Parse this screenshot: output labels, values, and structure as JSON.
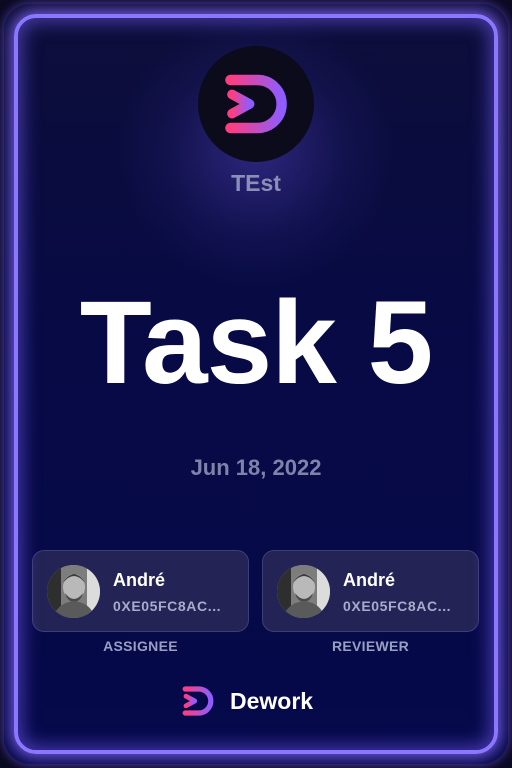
{
  "organization": {
    "name": "TEst"
  },
  "task": {
    "title": "Task 5",
    "date": "Jun 18, 2022"
  },
  "assignee": {
    "name": "André",
    "address": "0XE05FC8AC...",
    "role_label": "ASSIGNEE"
  },
  "reviewer": {
    "name": "André",
    "address": "0XE05FC8AC...",
    "role_label": "REVIEWER"
  },
  "footer": {
    "brand": "Dework"
  },
  "colors": {
    "accent_border": "#8b77ff",
    "logo_gradient_start": "#ff3d7f",
    "logo_gradient_end": "#8f5cff",
    "background": "#06094a"
  },
  "icons": {
    "org_logo": "dework-logo-icon",
    "brand_logo": "dework-logo-icon",
    "avatar": "user-avatar"
  }
}
